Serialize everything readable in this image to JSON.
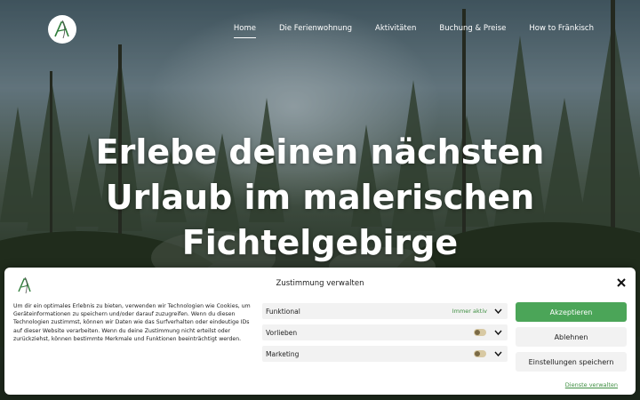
{
  "nav": {
    "items": [
      {
        "label": "Home",
        "active": true
      },
      {
        "label": "Die Ferienwohnung",
        "active": false
      },
      {
        "label": "Aktivitäten",
        "active": false
      },
      {
        "label": "Buchung & Preise",
        "active": false
      },
      {
        "label": "How to Fränkisch",
        "active": false
      }
    ]
  },
  "hero": {
    "headline_line1": "Erlebe deinen nächsten",
    "headline_line2": "Urlaub im malerischen",
    "headline_line3": "Fichtelgebirge"
  },
  "consent": {
    "title": "Zustimmung verwalten",
    "description": "Um dir ein optimales Erlebnis zu bieten, verwenden wir Technologien wie Cookies, um Geräteinformationen zu speichern und/oder darauf zuzugreifen. Wenn du diesen Technologien zustimmst, können wir Daten wie das Surfverhalten oder eindeutige IDs auf dieser Website verarbeiten. Wenn du deine Zustimmung nicht erteilst oder zurückziehst, können bestimmte Merkmale und Funktionen beeinträchtigt werden.",
    "categories": [
      {
        "label": "Funktional",
        "status": "Immer aktiv"
      },
      {
        "label": "Vorlieben",
        "status": ""
      },
      {
        "label": "Marketing",
        "status": ""
      }
    ],
    "buttons": {
      "accept": "Akzeptieren",
      "deny": "Ablehnen",
      "save": "Einstellungen speichern"
    },
    "services_link": "Dienste verwalten"
  },
  "colors": {
    "accent_green": "#4ba558",
    "link_green": "#3e8e41"
  },
  "icons": {
    "logo": "logo-icon",
    "close": "close-icon",
    "chevron": "chevron-down-icon"
  }
}
